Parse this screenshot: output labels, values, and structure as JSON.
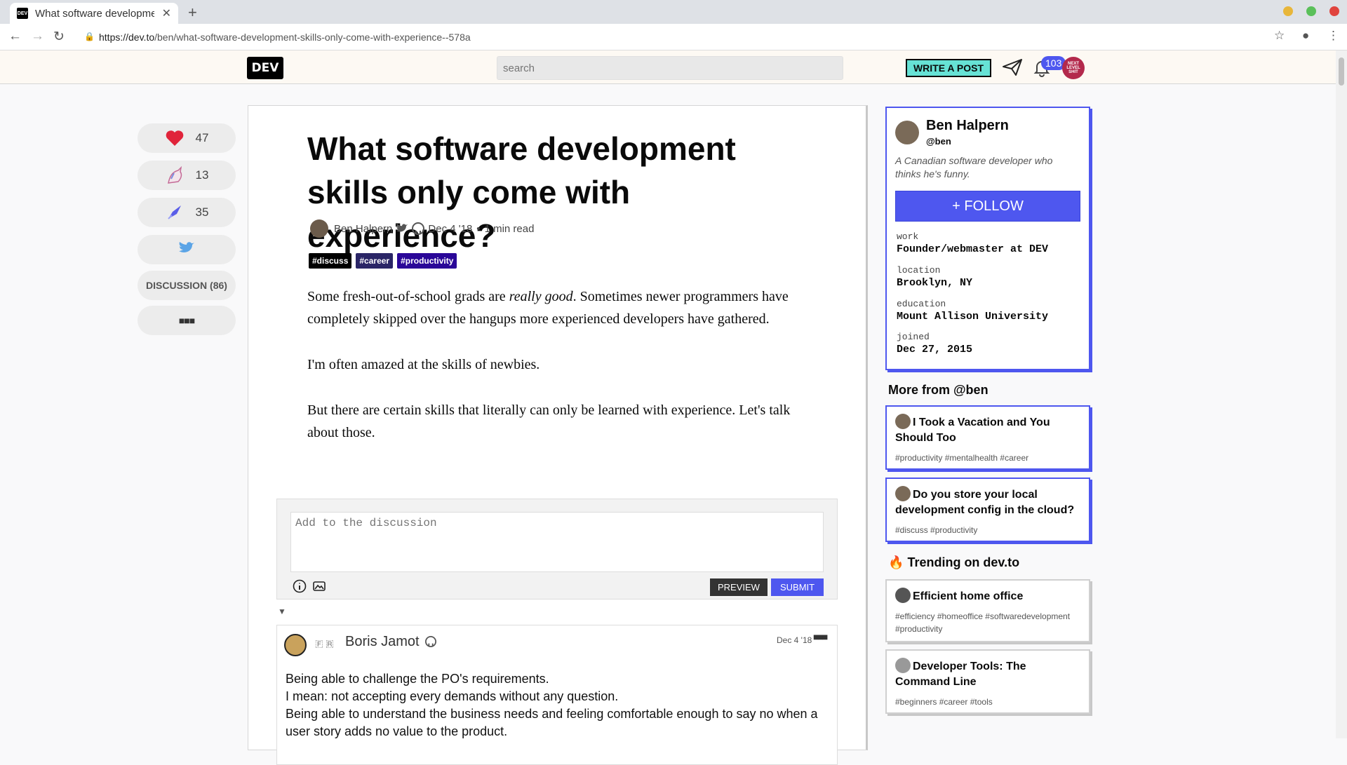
{
  "browser": {
    "tab_title": "What software developme",
    "favicon": "DEV",
    "url_host": "https://dev.to",
    "url_path": "/ben/what-software-development-skills-only-come-with-experience--578a"
  },
  "header": {
    "logo": "DEV",
    "search_placeholder": "search",
    "write_label": "WRITE A POST",
    "notifications_count": "103",
    "avatar_text": "NEXT LEVEL SHIT"
  },
  "rail": {
    "hearts": "47",
    "unicorns": "13",
    "saves": "35",
    "discussion": "DISCUSSION (86)"
  },
  "article": {
    "title": "What software development skills only come with experience?",
    "author": "Ben Halpern",
    "date": "Dec 4 '18",
    "read_time": "1 min read",
    "tags": [
      {
        "label": "#discuss",
        "color": "#000000"
      },
      {
        "label": "#career",
        "color": "#2a2566"
      },
      {
        "label": "#productivity",
        "color": "#2a0798"
      }
    ],
    "p1_a": "Some fresh-out-of-school grads are ",
    "p1_em": "really good",
    "p1_b": ". Sometimes newer programmers have completely skipped over the hangups more experienced developers have gathered.",
    "p2": "I'm often amazed at the skills of newbies.",
    "p3": "But there are certain skills that literally can only be learned with experience. Let's talk about those."
  },
  "comment_form": {
    "placeholder": "Add to the discussion",
    "preview": "PREVIEW",
    "submit": "SUBMIT"
  },
  "comment": {
    "author": "Boris Jamot",
    "flags": "🇫 🇷",
    "date": "Dec 4 '18",
    "line1": "Being able to challenge the PO's requirements.",
    "line2": "I mean: not accepting every demands without any question.",
    "line3": "Being able to understand the business needs and feeling comfortable enough to say no when a user story adds no value to the product."
  },
  "profile": {
    "name": "Ben Halpern",
    "handle": "@ben",
    "bio": "A Canadian software developer who thinks he's funny.",
    "follow": "+ FOLLOW",
    "fields": [
      {
        "label": "work",
        "value": "Founder/webmaster at DEV"
      },
      {
        "label": "location",
        "value": "Brooklyn, NY"
      },
      {
        "label": "education",
        "value": "Mount Allison University"
      },
      {
        "label": "joined",
        "value": "Dec 27, 2015"
      }
    ]
  },
  "more_from": {
    "heading": "More from @ben",
    "items": [
      {
        "title": "I Took a Vacation and You Should Too",
        "tags": "#productivity #mentalhealth #career"
      },
      {
        "title": "Do you store your local development config in the cloud?",
        "tags": "#discuss #productivity"
      }
    ]
  },
  "trending": {
    "heading": "Trending on dev.to",
    "icon": "fire-icon",
    "items": [
      {
        "title": "Efficient home office",
        "tags": "#efficiency #homeoffice #softwaredevelopment #productivity"
      },
      {
        "title": "Developer Tools: The Command Line",
        "tags": "#beginners #career #tools"
      }
    ]
  },
  "colors": {
    "accent": "#4e57ef",
    "write_button": "#66e2d5"
  }
}
